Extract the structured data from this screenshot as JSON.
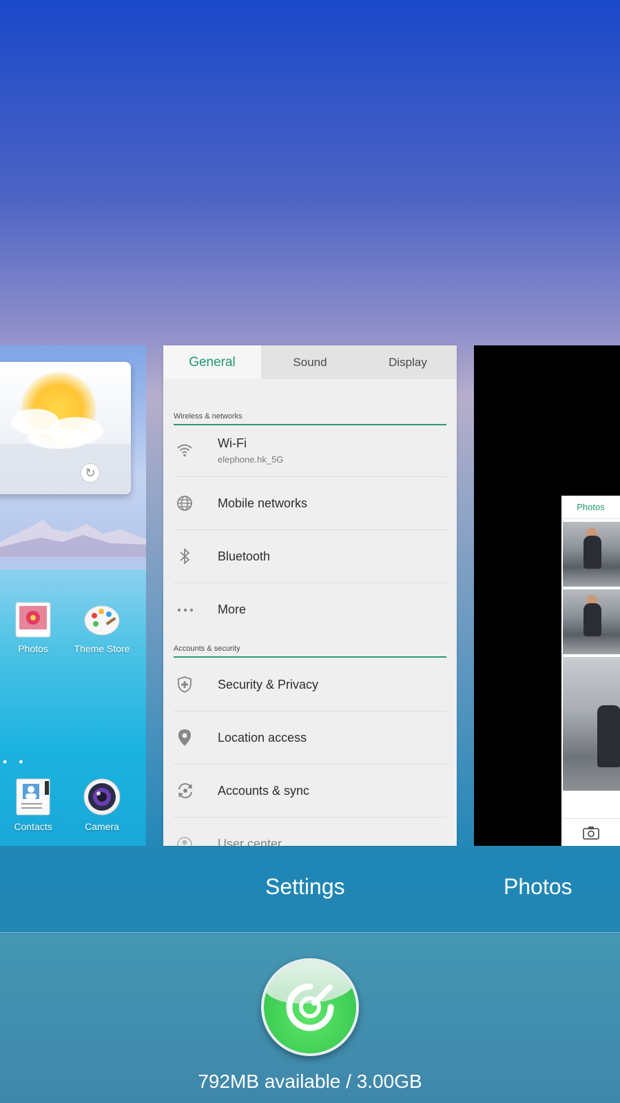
{
  "home_screen": {
    "apps": [
      {
        "label": "Photos",
        "icon": "photos-app-icon"
      },
      {
        "label": "Theme Store",
        "icon": "theme-store-icon"
      },
      {
        "label": "Contacts",
        "icon": "contacts-app-icon"
      },
      {
        "label": "Camera",
        "icon": "camera-app-icon"
      }
    ],
    "page_dots": "• •"
  },
  "settings": {
    "tabs": [
      {
        "label": "General",
        "active": true
      },
      {
        "label": "Sound",
        "active": false
      },
      {
        "label": "Display",
        "active": false
      }
    ],
    "sections": [
      {
        "header": "Wireless & networks",
        "items": [
          {
            "title": "Wi-Fi",
            "subtitle": "elephone.hk_5G",
            "icon": "wifi-icon"
          },
          {
            "title": "Mobile networks",
            "icon": "globe-icon"
          },
          {
            "title": "Bluetooth",
            "icon": "bluetooth-icon"
          },
          {
            "title": "More",
            "icon": "more-dots-icon"
          }
        ]
      },
      {
        "header": "Accounts & security",
        "items": [
          {
            "title": "Security & Privacy",
            "icon": "shield-icon"
          },
          {
            "title": "Location access",
            "icon": "location-pin-icon"
          },
          {
            "title": "Accounts & sync",
            "icon": "sync-icon"
          },
          {
            "title": "User center",
            "icon": "user-icon"
          }
        ]
      }
    ]
  },
  "photos": {
    "header": "Photos"
  },
  "card_labels": {
    "settings": "Settings",
    "photos": "Photos"
  },
  "memory": {
    "text": "792MB available / 3.00GB"
  },
  "colors": {
    "accent_green": "#1f9a6b",
    "clean_button": "#3fcf55"
  }
}
